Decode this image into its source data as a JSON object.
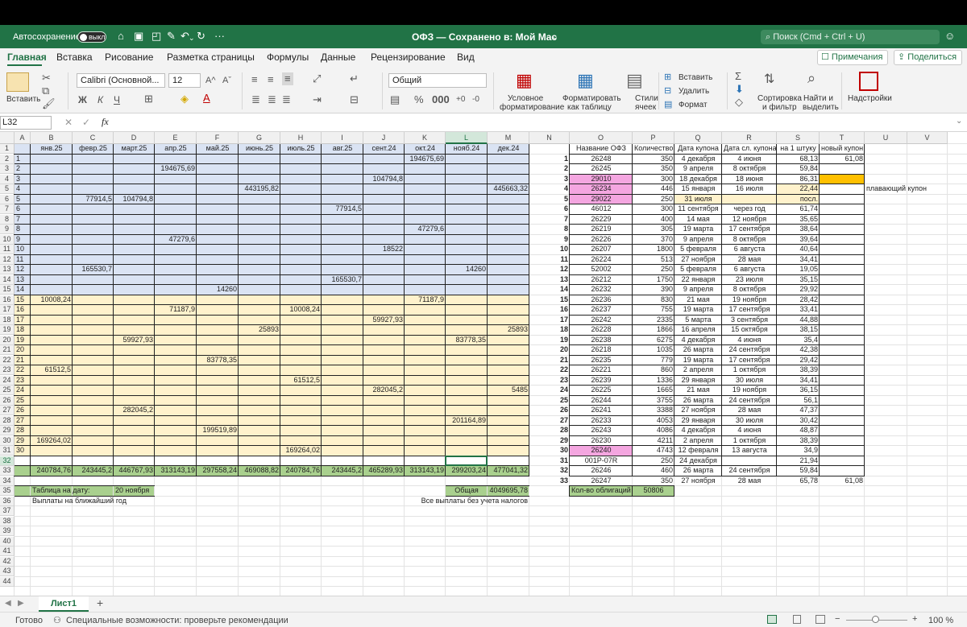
{
  "app": {
    "autosave_label": "Автосохранение",
    "autosave_state": "выкл",
    "title": "ОФЗ — Сохранено в: Мой Mac",
    "search_placeholder": "Поиск (Cmd + Ctrl + U)"
  },
  "menu": {
    "tabs": [
      "Главная",
      "Вставка",
      "Рисование",
      "Разметка страницы",
      "Формулы",
      "Данные",
      "Рецензирование",
      "Вид"
    ],
    "comments": "Примечания",
    "share": "Поделиться"
  },
  "ribbon": {
    "paste": "Вставить",
    "font_name": "Calibri (Основной...",
    "font_size": "12",
    "bold": "Ж",
    "italic": "К",
    "underline": "Ч",
    "number_format": "Общий",
    "cond_format": [
      "Условное",
      "форматирование"
    ],
    "format_table": [
      "Форматировать",
      "как таблицу"
    ],
    "cell_styles": [
      "Стили",
      "ячеек"
    ],
    "insert": "Вставить",
    "delete": "Удалить",
    "format": "Формат",
    "sort": [
      "Сортировка",
      "и фильтр"
    ],
    "find": [
      "Найти и",
      "выделить"
    ],
    "addins": "Надстройки",
    "percent": "%",
    "comma": "000"
  },
  "formula_bar": {
    "cell_ref": "L32",
    "fx": "fx",
    "cancel": "✕",
    "confirm": "✓",
    "value": ""
  },
  "sheet": {
    "col_letters": [
      "A",
      "B",
      "C",
      "D",
      "E",
      "F",
      "G",
      "H",
      "I",
      "J",
      "K",
      "L",
      "M",
      "N",
      "O",
      "P",
      "Q",
      "R",
      "S",
      "T",
      "U",
      "V"
    ],
    "row_count": 44,
    "selected_cell": "L32",
    "month_headers": [
      "янв.25",
      "февр.25",
      "март.25",
      "апр.25",
      "май.25",
      "июнь.25",
      "июль.25",
      "авг.25",
      "сент.24",
      "окт.24",
      "нояб.24",
      "дек.24"
    ],
    "payments": [
      {
        "r": 2,
        "c": "K",
        "v": "194675,69"
      },
      {
        "r": 3,
        "c": "E",
        "v": "194675,69"
      },
      {
        "r": 4,
        "c": "J",
        "v": "104794,8"
      },
      {
        "r": 5,
        "c": "G",
        "v": "443195,82"
      },
      {
        "r": 5,
        "c": "M",
        "v": "445663,32"
      },
      {
        "r": 6,
        "c": "C",
        "v": "77914,5"
      },
      {
        "r": 6,
        "c": "D",
        "v": "104794,8"
      },
      {
        "r": 7,
        "c": "I",
        "v": "77914,5"
      },
      {
        "r": 9,
        "c": "K",
        "v": "47279,6"
      },
      {
        "r": 10,
        "c": "E",
        "v": "47279,6"
      },
      {
        "r": 11,
        "c": "J",
        "v": "18522"
      },
      {
        "r": 13,
        "c": "C",
        "v": "165530,7"
      },
      {
        "r": 13,
        "c": "L",
        "v": "14260"
      },
      {
        "r": 14,
        "c": "I",
        "v": "165530,7"
      },
      {
        "r": 15,
        "c": "F",
        "v": "14260"
      },
      {
        "r": 16,
        "c": "B",
        "v": "10008,24"
      },
      {
        "r": 16,
        "c": "K",
        "v": "71187,9"
      },
      {
        "r": 17,
        "c": "E",
        "v": "71187,9"
      },
      {
        "r": 17,
        "c": "H",
        "v": "10008,24"
      },
      {
        "r": 18,
        "c": "J",
        "v": "59927,93"
      },
      {
        "r": 19,
        "c": "G",
        "v": "25893"
      },
      {
        "r": 19,
        "c": "M",
        "v": "25893"
      },
      {
        "r": 20,
        "c": "D",
        "v": "59927,93"
      },
      {
        "r": 20,
        "c": "L",
        "v": "83778,35"
      },
      {
        "r": 22,
        "c": "F",
        "v": "83778,35"
      },
      {
        "r": 23,
        "c": "B",
        "v": "61512,5"
      },
      {
        "r": 24,
        "c": "H",
        "v": "61512,5"
      },
      {
        "r": 25,
        "c": "J",
        "v": "282045,2"
      },
      {
        "r": 25,
        "c": "M",
        "v": "5485"
      },
      {
        "r": 27,
        "c": "D",
        "v": "282045,2"
      },
      {
        "r": 28,
        "c": "L",
        "v": "201164,89"
      },
      {
        "r": 29,
        "c": "F",
        "v": "199519,89"
      },
      {
        "r": 30,
        "c": "B",
        "v": "169264,02"
      },
      {
        "r": 31,
        "c": "H",
        "v": "169264,02"
      }
    ],
    "totals": [
      "240784,76",
      "243445,2",
      "446767,93",
      "313143,19",
      "297558,24",
      "469088,82",
      "240784,76",
      "243445,2",
      "465289,93",
      "313143,19",
      "299203,24",
      "477041,32"
    ],
    "date_label": "Таблица на дату:",
    "date_value": "20 ноября",
    "total_label": "Общая",
    "total_value": "4049695,78",
    "note_year": "Выплаты на ближайший год",
    "note_all": "Все выплаты без учета налогов",
    "bond_headers": [
      "Название ОФЗ",
      "Количество",
      "Дата купона",
      "Дата сл. купона",
      "на 1 штуку",
      "новый купон"
    ],
    "bonds": [
      [
        "26248",
        "350",
        "4 декабря",
        "4 июня",
        "68,13",
        "61,08"
      ],
      [
        "26245",
        "350",
        "9 апреля",
        "8 октября",
        "59,84",
        ""
      ],
      [
        "29010",
        "300",
        "18 декабря",
        "18 июня",
        "86,31",
        ""
      ],
      [
        "26234",
        "446",
        "15 января",
        "16 июля",
        "22,44",
        ""
      ],
      [
        "29022",
        "250",
        "31 июля",
        "",
        "посл.",
        ""
      ],
      [
        "46012",
        "300",
        "11 сентября",
        "через год",
        "61,74",
        ""
      ],
      [
        "26229",
        "400",
        "14 мая",
        "12 ноября",
        "35,65",
        ""
      ],
      [
        "26219",
        "305",
        "19 марта",
        "17 сентября",
        "38,64",
        ""
      ],
      [
        "26226",
        "370",
        "9 апреля",
        "8 октября",
        "39,64",
        ""
      ],
      [
        "26207",
        "1800",
        "5 февраля",
        "6 августа",
        "40,64",
        ""
      ],
      [
        "26224",
        "513",
        "27 ноября",
        "28 мая",
        "34,41",
        ""
      ],
      [
        "52002",
        "250",
        "5 февраля",
        "6 августа",
        "19,05",
        ""
      ],
      [
        "26212",
        "1750",
        "22 января",
        "23 июля",
        "35,15",
        ""
      ],
      [
        "26232",
        "390",
        "9 апреля",
        "8 октября",
        "29,92",
        ""
      ],
      [
        "26236",
        "830",
        "21 мая",
        "19 ноября",
        "28,42",
        ""
      ],
      [
        "26237",
        "755",
        "19 марта",
        "17 сентября",
        "33,41",
        ""
      ],
      [
        "26242",
        "2335",
        "5 марта",
        "3 сентября",
        "44,88",
        ""
      ],
      [
        "26228",
        "1866",
        "16 апреля",
        "15 октября",
        "38,15",
        ""
      ],
      [
        "26238",
        "6275",
        "4 декабря",
        "4 июня",
        "35,4",
        ""
      ],
      [
        "26218",
        "1035",
        "26 марта",
        "24 сентября",
        "42,38",
        ""
      ],
      [
        "26235",
        "779",
        "19 марта",
        "17 сентября",
        "29,42",
        ""
      ],
      [
        "26221",
        "860",
        "2 апреля",
        "1 октября",
        "38,39",
        ""
      ],
      [
        "26239",
        "1336",
        "29 января",
        "30 июля",
        "34,41",
        ""
      ],
      [
        "26225",
        "1665",
        "21 мая",
        "19 ноября",
        "36,15",
        ""
      ],
      [
        "26244",
        "3755",
        "26 марта",
        "24 сентября",
        "56,1",
        ""
      ],
      [
        "26241",
        "3388",
        "27 ноября",
        "28 мая",
        "47,37",
        ""
      ],
      [
        "26233",
        "4053",
        "29 января",
        "30 июля",
        "30,42",
        ""
      ],
      [
        "26243",
        "4086",
        "4 декабря",
        "4 июня",
        "48,87",
        ""
      ],
      [
        "26230",
        "4211",
        "2 апреля",
        "1 октября",
        "38,39",
        ""
      ],
      [
        "26240",
        "4743",
        "12 февраля",
        "13 августа",
        "34,9",
        ""
      ],
      [
        "001P-07R",
        "250",
        "24 декабря",
        "",
        "21,94",
        ""
      ],
      [
        "26246",
        "460",
        "26 марта",
        "24 сентября",
        "59,84",
        ""
      ],
      [
        "26247",
        "350",
        "27 ноября",
        "28 мая",
        "65,78",
        "61,08"
      ]
    ],
    "bonds_count_label": "Кол-во облигаций",
    "bonds_count_value": "50806",
    "floating_note": "плавающий купон"
  },
  "sheet_tab": "Лист1",
  "add_sheet": "+",
  "status": {
    "ready": "Готово",
    "accessibility": "Специальные возможности: проверьте рекомендации",
    "zoom": "100 %"
  },
  "colors": {
    "brand": "#217346",
    "blue_fill": "#dae3f3",
    "yellow_fill": "#fff2cc",
    "green_fill": "#a9d08e",
    "pink_fill": "#f4a6e0",
    "orange_fill": "#ffc000"
  }
}
